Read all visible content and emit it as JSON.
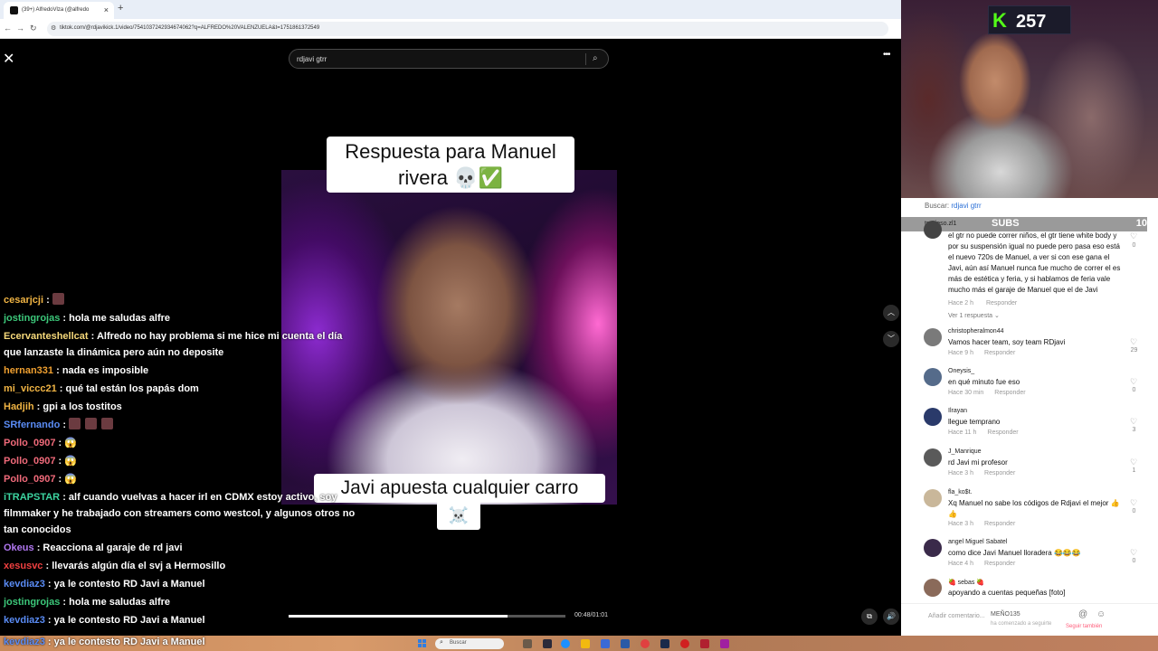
{
  "browser": {
    "tab_title": "(39+) AlfredoVlza (@alfredo",
    "tab_close": "×",
    "new_tab": "+",
    "url": "tiktok.com/@rdjavikick.1/video/7541037242934674062?q=ALFREDO%20VALENZUELA&t=1751861372549"
  },
  "stage": {
    "search_value": "rdjavi gtrr",
    "caption_top": "Respuesta para Manuel rivera 💀✅",
    "caption_bottom": "Javi apuesta cualquier carro",
    "caption_bottom_emoji": "☠️",
    "time": "00:48/01:01",
    "progress": 0.79
  },
  "chat": [
    {
      "user": "cesarjcji",
      "text": "",
      "color": "#f0b444",
      "emotes": 1
    },
    {
      "user": "jostingrojas",
      "text": "hola me saludas alfre",
      "color": "#3cc87a"
    },
    {
      "user": "Ecervanteshellcat",
      "text": "Alfredo no hay problema si me hice mi cuenta el día que lanzaste la dinámica pero aún no deposite",
      "color": "#f6d97a"
    },
    {
      "user": "hernan331",
      "text": "nada es imposible",
      "color": "#f0a030"
    },
    {
      "user": "mi_viccc21",
      "text": "qué tal están los papás dom",
      "color": "#f0b444"
    },
    {
      "user": "Hadjih",
      "text": "gpi a los tostitos",
      "color": "#f0b444"
    },
    {
      "user": "SRfernando",
      "text": "",
      "color": "#5a8cf5",
      "emotes": 3
    },
    {
      "user": "Pollo_0907",
      "text": "😱",
      "color": "#f06a7a"
    },
    {
      "user": "Pollo_0907",
      "text": "😱",
      "color": "#f06a7a"
    },
    {
      "user": "Pollo_0907",
      "text": "😱",
      "color": "#f06a7a"
    },
    {
      "user": "iTRAPSTAR",
      "text": "alf cuando vuelvas a hacer irl en CDMX estoy activo, soy filmmaker y he trabajado con streamers como westcol, y algunos otros no tan conocidos",
      "color": "#3cd4a0"
    },
    {
      "user": "Okeus",
      "text": "Reacciona al garaje de rd javi",
      "color": "#b077f0"
    },
    {
      "user": "xesusvc",
      "text": "llevarás algún día el svj a Hermosillo",
      "color": "#f04040"
    },
    {
      "user": "kevdiaz3",
      "text": "ya le contesto RD Javi a Manuel",
      "color": "#5a8cf5"
    },
    {
      "user": "jostingrojas",
      "text": "hola me saludas alfre",
      "color": "#3cc87a"
    },
    {
      "user": "kevdiaz3",
      "text": "ya le contesto RD Javi a Manuel",
      "color": "#5a8cf5"
    }
  ],
  "webcam": {
    "kick_logo": "K",
    "kick_count": "257"
  },
  "panel": {
    "buscar_label": "Buscar:",
    "buscar_term": "rdjavi gtrr",
    "subs_dot": "0",
    "subs_name": "travieso.zl1",
    "subs_label": "SUBS",
    "subs_count": "10",
    "first_text": "el gtr no puede correr niños, el gtr tiene white body y por su suspensión igual no puede pero pasa eso está el nuevo 720s de Manuel, a ver si con ese gana el Javi, aún así Manuel nunca fue mucho de correr el es más de estética y feria, y si hablamos de feria vale mucho más el garaje de Manuel que el de Javi",
    "first_time": "Hace 2 h",
    "first_likes": "0",
    "reply_label": "Responder",
    "view_replies": "Ver 1 respuesta ⌄",
    "comments": [
      {
        "user": "christopheralmon44",
        "text": "Vamos hacer team, soy team RDjavi",
        "time": "Hace 9 h",
        "likes": "29",
        "avatar": "#7a7a7a"
      },
      {
        "user": "Oneysis_",
        "text": "en qué minuto fue eso",
        "time": "Hace 30 min",
        "likes": "0",
        "avatar": "#556b8a"
      },
      {
        "user": "Ilrayan",
        "text": "llegue temprano",
        "time": "Hace 11 h",
        "likes": "3",
        "avatar": "#2a3a6a"
      },
      {
        "user": "J_Manrique",
        "text": "rd Javi mi profesor",
        "time": "Hace 3 h",
        "likes": "1",
        "avatar": "#5a5a5a"
      },
      {
        "user": "fla_ko$t.",
        "text": "Xq Manuel no sabe los códigos de Rdjavi el mejor 👍👍",
        "time": "Hace 3 h",
        "likes": "0",
        "avatar": "#c9b79a"
      },
      {
        "user": "angel Miguel Sabatel",
        "text": "como dice Javi Manuel lloradera 😂😂😂",
        "time": "Hace 4 h",
        "likes": "0",
        "avatar": "#3a2a4a"
      },
      {
        "user": "🍓 sebas 🍓",
        "text": "apoyando a cuentas pequeñas [foto]",
        "time": "",
        "likes": "",
        "avatar": "#8a6a5a"
      }
    ],
    "add_comment": "Añadir comentario...",
    "footer_user": "MEÑO135",
    "footer_sub": "ha comenzado a seguirte",
    "footer_follow": "Seguir también"
  },
  "taskbar": {
    "overlay_user": "kevdiaz3",
    "overlay_text": "ya le contesto RD Javi a Manuel",
    "search_label": "Buscar"
  },
  "icons": [
    "close-icon",
    "search-icon",
    "more-icon",
    "chevron-up-icon",
    "chevron-down-icon",
    "volume-icon",
    "pip-icon",
    "heart-icon",
    "at-icon",
    "emoji-icon",
    "windows-icon"
  ]
}
